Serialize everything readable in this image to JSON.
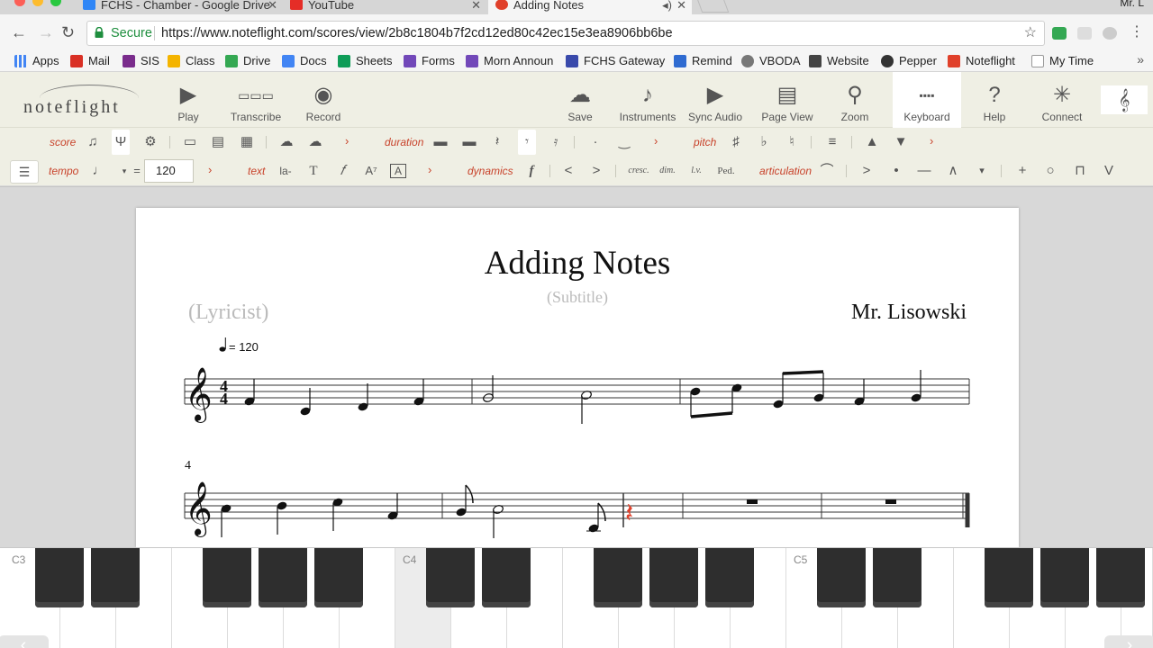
{
  "browser": {
    "tabs": [
      {
        "title": "FCHS - Chamber - Google Drive",
        "favicon_color": "#2f86f6"
      },
      {
        "title": "YouTube",
        "favicon_color": "#e52d27"
      },
      {
        "title": "Adding Notes",
        "favicon_color": "#e0402a"
      }
    ],
    "user_label": "Mr. L",
    "secure_label": "Secure",
    "url": "https://www.noteflight.com/scores/view/2b8c1804b7f2cd12ed80c42ec15e3ea8906bb6be",
    "bookmarks": [
      {
        "label": "Apps",
        "color": "#4285f4"
      },
      {
        "label": "Mail",
        "color": "#d93025"
      },
      {
        "label": "SIS",
        "color": "#7a2c8c"
      },
      {
        "label": "Class",
        "color": "#f4b400"
      },
      {
        "label": "Drive",
        "color": "#34a853"
      },
      {
        "label": "Docs",
        "color": "#4285f4"
      },
      {
        "label": "Sheets",
        "color": "#0f9d58"
      },
      {
        "label": "Forms",
        "color": "#7248b9"
      },
      {
        "label": "Morn Announ",
        "color": "#7248b9"
      },
      {
        "label": "FCHS Gateway",
        "color": "#3949ab"
      },
      {
        "label": "Remind",
        "color": "#2f6bd1"
      },
      {
        "label": "VBODA",
        "color": "#777777"
      },
      {
        "label": "Website",
        "color": "#444444"
      },
      {
        "label": "Pepper",
        "color": "#333333"
      },
      {
        "label": "Noteflight",
        "color": "#e0402a"
      },
      {
        "label": "My Time",
        "color": "#bbbbbb"
      }
    ]
  },
  "app": {
    "logo": "noteflight",
    "toolbar": [
      {
        "label": "Play",
        "icon": "play-icon"
      },
      {
        "label": "Transcribe",
        "icon": "transcribe-icon"
      },
      {
        "label": "Record",
        "icon": "record-icon"
      },
      {
        "label": "Save",
        "icon": "cloud-upload-icon"
      },
      {
        "label": "Instruments",
        "icon": "guitar-icon"
      },
      {
        "label": "Sync Audio",
        "icon": "sync-audio-icon"
      },
      {
        "label": "Page View",
        "icon": "page-icon"
      },
      {
        "label": "Zoom",
        "icon": "zoom-icon"
      },
      {
        "label": "Keyboard",
        "icon": "keyboard-icon"
      },
      {
        "label": "Help",
        "icon": "help-icon"
      },
      {
        "label": "Connect",
        "icon": "connect-icon"
      }
    ],
    "palette": {
      "score": "score",
      "duration": "duration",
      "pitch": "pitch",
      "tempo": "tempo",
      "tempo_value": "120",
      "text": "text",
      "dynamics": "dynamics",
      "articulation": "articulation",
      "text_lyric": "la-",
      "text_T": "T",
      "dyn_cresc": "cresc.",
      "dyn_dim": "dim.",
      "dyn_lv": "l.v.",
      "dyn_ped": "Ped."
    }
  },
  "score": {
    "title": "Adding Notes",
    "subtitle": "(Subtitle)",
    "lyricist": "(Lyricist)",
    "composer": "Mr. Lisowski",
    "tempo_mark": "= 120",
    "time_signature": "4/4",
    "measure_number": "4"
  },
  "keyboard": {
    "labels": [
      "C3",
      "C4",
      "C5"
    ]
  }
}
